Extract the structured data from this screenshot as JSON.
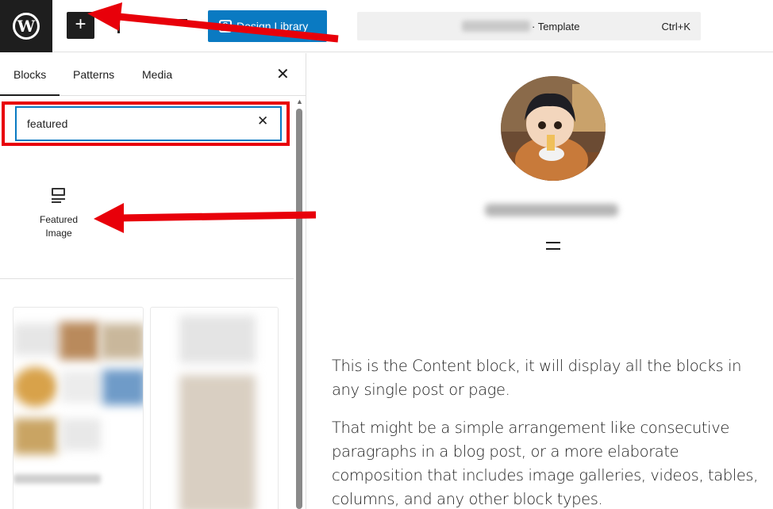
{
  "header": {
    "logo": "wordpress-logo",
    "logo_glyph": "W",
    "add_block_label": "+",
    "design_library_label": "Design Library",
    "design_library_icon": "S",
    "command_bar_suffix": "· Template",
    "command_bar_shortcut": "Ctrl+K"
  },
  "sidebar": {
    "tabs": [
      {
        "label": "Blocks",
        "active": true
      },
      {
        "label": "Patterns",
        "active": false
      },
      {
        "label": "Media",
        "active": false
      }
    ],
    "close_label": "✕",
    "search": {
      "value": "featured",
      "clear_label": "✕"
    },
    "results": [
      {
        "label": "Featured Image",
        "icon": "featured-image-icon"
      }
    ]
  },
  "canvas": {
    "paragraphs": [
      "This is the Content block, it will display all the blocks in any single post or page.",
      "That might be a simple arrangement like consecutive paragraphs in a blog post, or a more elaborate composition that includes image galleries, videos, tables, columns, and any other block types."
    ]
  },
  "colors": {
    "accent": "#0a7ac2",
    "annotation": "#e8000a",
    "dark": "#1e1e1e"
  }
}
